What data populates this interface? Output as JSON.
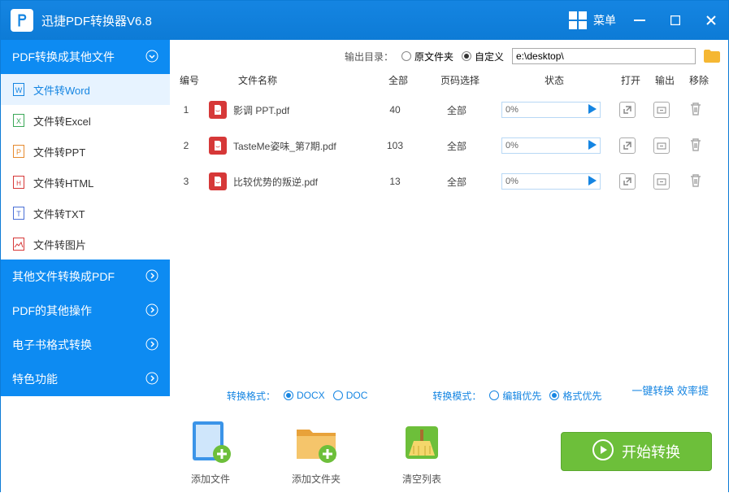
{
  "title": "迅捷PDF转换器V6.8",
  "menu_label": "菜单",
  "sidebar": {
    "categories": [
      {
        "label": "PDF转换成其他文件",
        "expanded": true
      },
      {
        "label": "其他文件转换成PDF",
        "expanded": false
      },
      {
        "label": "PDF的其他操作",
        "expanded": false
      },
      {
        "label": "电子书格式转换",
        "expanded": false
      },
      {
        "label": "特色功能",
        "expanded": false
      }
    ],
    "subitems": [
      {
        "label": "文件转Word",
        "color": "#1585e2",
        "selected": true
      },
      {
        "label": "文件转Excel",
        "color": "#3aa757"
      },
      {
        "label": "文件转PPT",
        "color": "#e68a2e"
      },
      {
        "label": "文件转HTML",
        "color": "#d63838"
      },
      {
        "label": "文件转TXT",
        "color": "#4a6fd6"
      },
      {
        "label": "文件转图片",
        "color": "#d63838"
      }
    ]
  },
  "output": {
    "label": "输出目录：",
    "opt_original": "原文件夹",
    "opt_custom": "自定义",
    "path": "e:\\desktop\\"
  },
  "table": {
    "headers": {
      "num": "编号",
      "name": "文件名称",
      "all": "全部",
      "page": "页码选择",
      "status": "状态",
      "open": "打开",
      "out": "输出",
      "del": "移除"
    },
    "rows": [
      {
        "num": "1",
        "name": "影调 PPT.pdf",
        "all": "40",
        "page": "全部",
        "pct": "0%"
      },
      {
        "num": "2",
        "name": "TasteMe姿味_第7期.pdf",
        "all": "103",
        "page": "全部",
        "pct": "0%"
      },
      {
        "num": "3",
        "name": "比较优势的叛逆.pdf",
        "all": "13",
        "page": "全部",
        "pct": "0%"
      }
    ]
  },
  "options": {
    "fmt_label": "转换格式：",
    "fmt_docx": "DOCX",
    "fmt_doc": "DOC",
    "mode_label": "转换模式：",
    "mode_edit": "编辑优先",
    "mode_format": "格式优先"
  },
  "bottom": {
    "add_file": "添加文件",
    "add_folder": "添加文件夹",
    "clear": "清空列表",
    "start": "开始转换",
    "quick": "一键转换  效率提"
  }
}
